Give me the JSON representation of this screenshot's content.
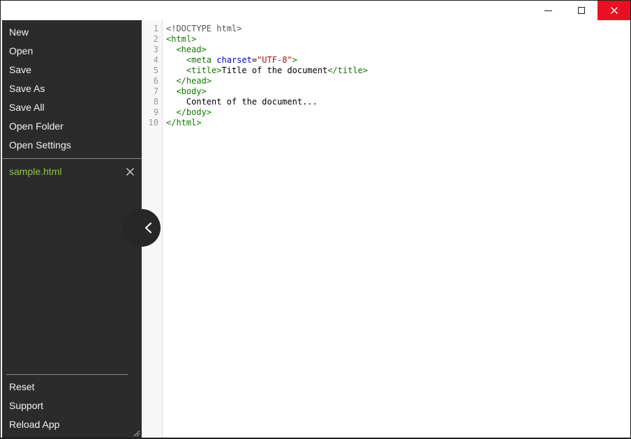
{
  "titlebar": {
    "controls": [
      "minimize",
      "maximize",
      "close"
    ],
    "close_bg": "#e81123"
  },
  "sidebar": {
    "bg": "#2b2b2b",
    "menu_items": [
      "New",
      "Open",
      "Save",
      "Save As",
      "Save All",
      "Open Folder",
      "Open Settings"
    ],
    "open_file": {
      "name": "sample.html",
      "color": "#8fc241",
      "close_icon": "x-icon"
    },
    "footer_items": [
      "Reset",
      "Support",
      "Reload App"
    ]
  },
  "editor": {
    "gutter_bg": "#f7f7f7",
    "line_number_color": "#999999",
    "colors": {
      "tag": "#117700",
      "attr": "#0000cc",
      "str": "#aa1111",
      "meta": "#555555",
      "text": "#000000"
    },
    "lines": [
      {
        "num": 1,
        "tokens": [
          {
            "t": "meta",
            "s": "<!DOCTYPE html>"
          }
        ]
      },
      {
        "num": 2,
        "tokens": [
          {
            "t": "tag",
            "s": "<html>"
          }
        ]
      },
      {
        "num": 3,
        "tokens": [
          {
            "t": "text",
            "s": "  "
          },
          {
            "t": "tag",
            "s": "<head>"
          }
        ]
      },
      {
        "num": 4,
        "tokens": [
          {
            "t": "text",
            "s": "    "
          },
          {
            "t": "tag",
            "s": "<meta "
          },
          {
            "t": "attr",
            "s": "charset"
          },
          {
            "t": "text",
            "s": "="
          },
          {
            "t": "str",
            "s": "\"UTF-8\""
          },
          {
            "t": "tag",
            "s": ">"
          }
        ]
      },
      {
        "num": 5,
        "tokens": [
          {
            "t": "text",
            "s": "    "
          },
          {
            "t": "tag",
            "s": "<title>"
          },
          {
            "t": "text",
            "s": "Title of the document"
          },
          {
            "t": "tag",
            "s": "</title>"
          }
        ]
      },
      {
        "num": 6,
        "tokens": [
          {
            "t": "text",
            "s": "  "
          },
          {
            "t": "tag",
            "s": "</head>"
          }
        ]
      },
      {
        "num": 7,
        "tokens": [
          {
            "t": "text",
            "s": "  "
          },
          {
            "t": "tag",
            "s": "<body>"
          }
        ]
      },
      {
        "num": 8,
        "tokens": [
          {
            "t": "text",
            "s": "    Content of the document..."
          }
        ]
      },
      {
        "num": 9,
        "tokens": [
          {
            "t": "text",
            "s": "  "
          },
          {
            "t": "tag",
            "s": "</body>"
          }
        ]
      },
      {
        "num": 10,
        "tokens": [
          {
            "t": "tag",
            "s": "</html>"
          }
        ]
      }
    ]
  }
}
